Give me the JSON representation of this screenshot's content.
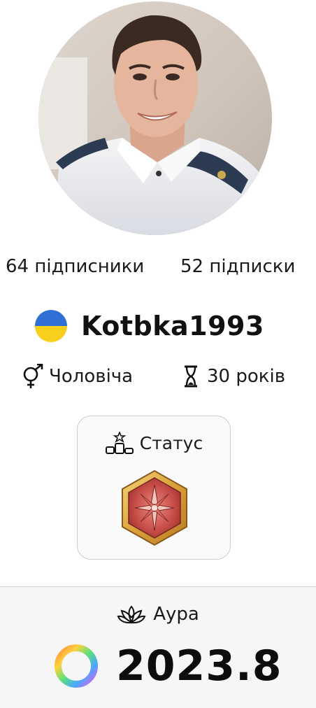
{
  "profile": {
    "avatar_icon": "user-photo",
    "followers_label": "64 підписники",
    "following_label": "52 підписки",
    "flag_icon": "ukraine-flag-icon",
    "flag_colors": [
      "#2f6fd6",
      "#f7cf1c"
    ],
    "username": "Kotbka1993",
    "gender_icon": "gender-icon",
    "gender": "Чоловіча",
    "age_icon": "hourglass-icon",
    "age": "30 років"
  },
  "status": {
    "icon": "podium-icon",
    "label": "Статус",
    "badge_icon": "compass-star-badge-icon",
    "badge_colors": [
      "#e8b94a",
      "#c7403e"
    ]
  },
  "aura": {
    "icon": "lotus-icon",
    "label": "Аура",
    "value": "2023.8",
    "ring_icon": "rainbow-ring-icon"
  }
}
